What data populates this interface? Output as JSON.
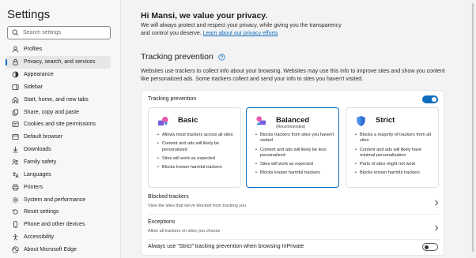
{
  "sidebar": {
    "title": "Settings",
    "search_placeholder": "Search settings",
    "items": [
      {
        "label": "Profiles",
        "icon": "profile-icon"
      },
      {
        "label": "Privacy, search, and services",
        "icon": "lock-icon",
        "active": true
      },
      {
        "label": "Appearance",
        "icon": "appearance-icon"
      },
      {
        "label": "Sidebar",
        "icon": "sidebar-icon"
      },
      {
        "label": "Start, home, and new tabs",
        "icon": "home-icon"
      },
      {
        "label": "Share, copy and paste",
        "icon": "share-icon"
      },
      {
        "label": "Cookies and site permissions",
        "icon": "cookie-icon"
      },
      {
        "label": "Default browser",
        "icon": "browser-icon"
      },
      {
        "label": "Downloads",
        "icon": "download-icon"
      },
      {
        "label": "Family safety",
        "icon": "family-icon"
      },
      {
        "label": "Languages",
        "icon": "language-icon"
      },
      {
        "label": "Printers",
        "icon": "printer-icon"
      },
      {
        "label": "System and performance",
        "icon": "system-icon"
      },
      {
        "label": "Reset settings",
        "icon": "reset-icon"
      },
      {
        "label": "Phone and other devices",
        "icon": "phone-icon"
      },
      {
        "label": "Accessibility",
        "icon": "accessibility-icon"
      },
      {
        "label": "About Microsoft Edge",
        "icon": "edge-icon"
      }
    ]
  },
  "main": {
    "greeting": "Hi Mansi, we value your privacy.",
    "intro_line1": "We will always protect and respect your privacy, while giving you the transparency",
    "intro_line2_prefix": "and control you deserve. ",
    "intro_link": "Learn about our privacy efforts",
    "tracking_heading": "Tracking prevention",
    "tracking_desc": "Websites use trackers to collect info about your browsing. Websites may use this info to improve sites and show you content like personalized ads. Some trackers collect and send your info to sites you haven't visited.",
    "card": {
      "title": "Tracking prevention",
      "toggle_on": true,
      "options": [
        {
          "name": "Basic",
          "subtitle": "",
          "selected": false,
          "icon": "basic-shapes-icon",
          "bullets": [
            "Allows most trackers across all sites",
            "Content and ads will likely be personalized",
            "Sites will work as expected",
            "Blocks known harmful trackers"
          ]
        },
        {
          "name": "Balanced",
          "subtitle": "(Recommended)",
          "selected": true,
          "icon": "balanced-scale-icon",
          "bullets": [
            "Blocks trackers from sites you haven't visited",
            "Content and ads will likely be less personalized",
            "Sites will work as expected",
            "Blocks known harmful trackers"
          ]
        },
        {
          "name": "Strict",
          "subtitle": "",
          "selected": false,
          "icon": "shield-icon",
          "bullets": [
            "Blocks a majority of trackers from all sites",
            "Content and ads will likely have minimal personalization",
            "Parts of sites might not work",
            "Blocks known harmful trackers"
          ]
        }
      ],
      "blocked_title": "Blocked trackers",
      "blocked_sub": "View the sites that we've blocked from tracking you",
      "exceptions_title": "Exceptions",
      "exceptions_sub": "Allow all trackers on sites you choose",
      "inprivate_label": "Always use “Strict” tracking prevention when browsing InPrivate",
      "inprivate_on": false
    }
  },
  "colors": {
    "accent": "#0f6cbd",
    "sidebar_bg": "#f7f7f7",
    "content_bg": "#f3f3f3"
  }
}
